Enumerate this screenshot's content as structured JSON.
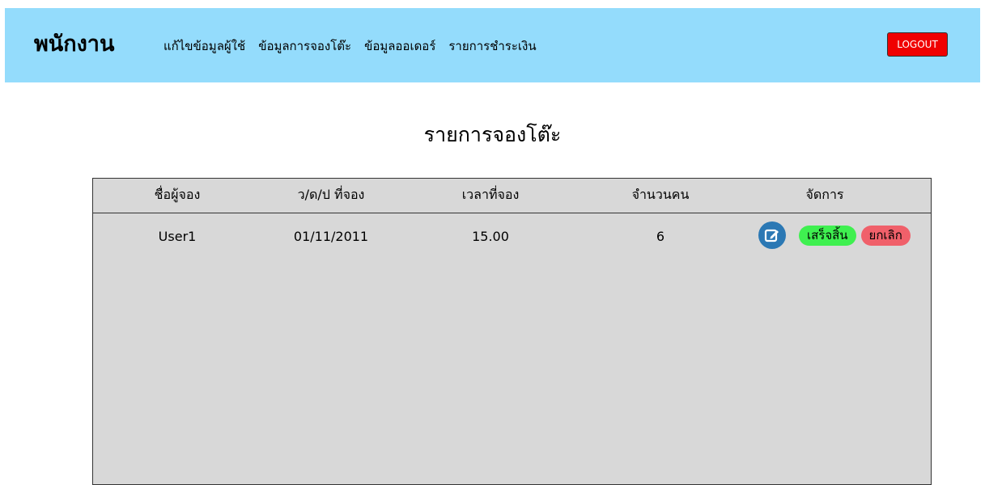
{
  "navbar": {
    "brand": "พนักงาน",
    "links": [
      "แก้ไขข้อมูลผู้ใช้",
      "ข้อมูลการจองโต๊ะ",
      "ข้อมูลออเดอร์",
      "รายการชำระเงิน"
    ],
    "logout_label": "LOGOUT"
  },
  "page": {
    "title": "รายการจองโต๊ะ"
  },
  "table": {
    "columns": [
      "ชื่อผู้จอง",
      "ว/ด/ป ที่จอง",
      "เวลาที่จอง",
      "จำนวนคน",
      "จัดการ"
    ],
    "rows": [
      {
        "name": "User1",
        "date": "01/11/2011",
        "time": "15.00",
        "people": "6",
        "actions": {
          "edit_icon": "edit-icon",
          "done_label": "เสร็จสิ้น",
          "cancel_label": "ยกเลิก"
        }
      }
    ]
  },
  "colors": {
    "navbar_bg": "#94dcfc",
    "logout_bg": "#f00000",
    "table_bg": "#d8d8d8",
    "edit_icon_bg": "#2b78b4",
    "done_bg": "#3ff050",
    "cancel_bg": "#f0606a"
  }
}
